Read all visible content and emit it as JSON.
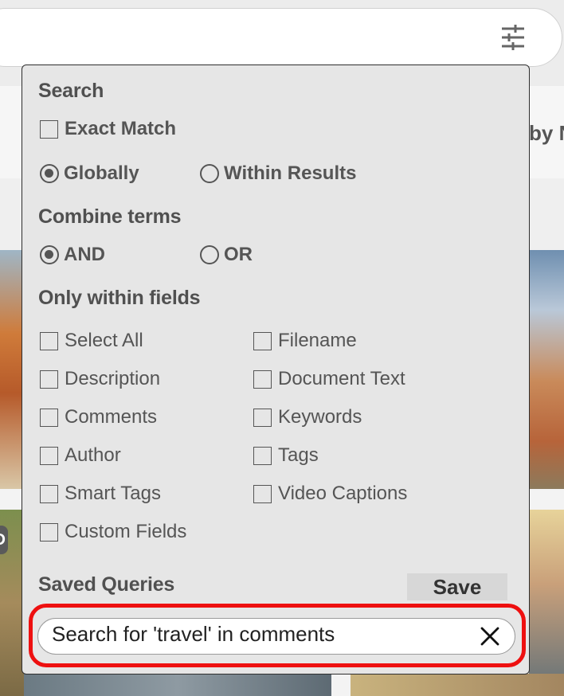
{
  "panel": {
    "search_heading": "Search",
    "exact_match": "Exact Match",
    "scope_globally": "Globally",
    "scope_within_results": "Within Results",
    "combine_heading": "Combine terms",
    "combine_and": "AND",
    "combine_or": "OR",
    "fields_heading": "Only within fields",
    "fields_left": [
      "Select All",
      "Description",
      "Comments",
      "Author",
      "Smart Tags",
      "Custom Fields"
    ],
    "fields_right": [
      "Filename",
      "Document Text",
      "Keywords",
      "Tags",
      "Video Captions"
    ],
    "saved_heading": "Saved Queries",
    "save_label": "Save",
    "saved_query": "Search for 'travel' in comments"
  },
  "background": {
    "sort_fragment": "by N",
    "badge_fragment": "D"
  },
  "colors": {
    "panel_bg": "#e6e6e6",
    "highlight": "#ee1010",
    "text": "#505050"
  },
  "icons": {
    "filter": "sliders-icon",
    "close": "close-icon"
  }
}
